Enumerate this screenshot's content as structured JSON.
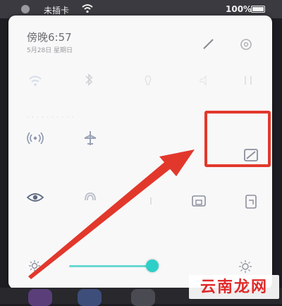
{
  "status_bar": {
    "carrier": "未插卡",
    "battery_text": "100%",
    "wifi_icon": "wifi-icon",
    "battery_icon": "battery-icon"
  },
  "panel": {
    "time": "傍晚6:57",
    "date": "5月28日 星期日",
    "edit_icon": "pencil-icon",
    "settings_icon": "gear-icon",
    "tile_row_caption": "· · · · · · · · · ·"
  },
  "tiles": {
    "row1": [
      "wifi-icon",
      "bluetooth-icon",
      "flashlight-icon",
      "sound-icon",
      "mobile-data-icon"
    ],
    "row2": [
      "hotspot-icon",
      "airplane-mode-icon",
      "screenshot-icon"
    ],
    "row3": [
      "eye-comfort-icon",
      "nfc-icon",
      "location-icon",
      "screen-record-icon",
      "auto-rotate-icon"
    ]
  },
  "brightness": {
    "level": 0.62,
    "accent_color": "#2cd0c8"
  },
  "annotation": {
    "highlight_color": "#e2382c",
    "arrow_color": "#e2382c"
  },
  "watermark": {
    "text": "云南龙网"
  }
}
